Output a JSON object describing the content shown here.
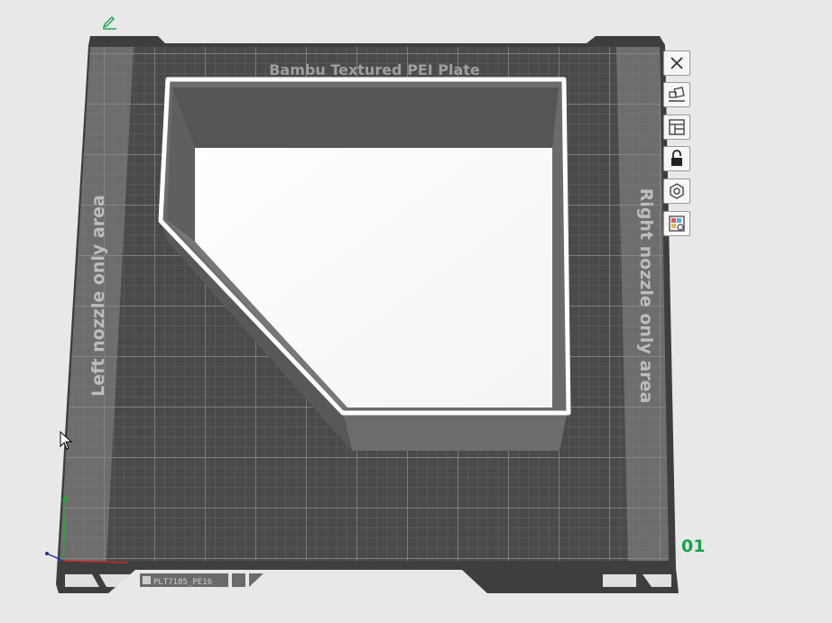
{
  "plate": {
    "title": "Bambu Textured PEI Plate",
    "left_zone_label": "Left nozzle only area",
    "right_zone_label": "Right nozzle only area",
    "plate_number": "01",
    "tag_label": "PLT7105_PE16"
  },
  "toolbar": {
    "items": [
      {
        "name": "close-plate-button",
        "icon": "close-icon"
      },
      {
        "name": "auto-arrange-button",
        "icon": "arrange-icon"
      },
      {
        "name": "plate-layout-button",
        "icon": "layout-icon"
      },
      {
        "name": "lock-plate-button",
        "icon": "lock-icon"
      },
      {
        "name": "plate-settings-button",
        "icon": "hexagon-settings-icon"
      },
      {
        "name": "filament-map-button",
        "icon": "filament-map-icon"
      }
    ]
  },
  "colors": {
    "background": "#e8e8e8",
    "plate": "#4a4a4a",
    "grid": "#7a7a7a",
    "zone": "#8a8a8a",
    "model_rim": "#ffffff",
    "model_inner": "#ffffff",
    "accent_green": "#17a34a"
  }
}
